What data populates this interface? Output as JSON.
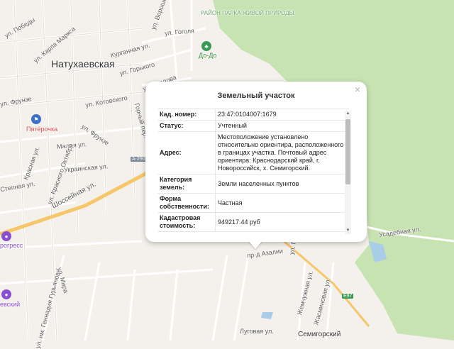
{
  "map": {
    "streets": [
      "ул. Победы",
      "ул. Карла Маркса",
      "ул. Вороши",
      "ул. Гоголя",
      "Курганная ул.",
      "ул. Горького",
      "ул. Чкалова",
      "ул. Котовского",
      "ул. Фрунзе",
      "Горный пер.",
      "ул. Фрунзе",
      "Малая ул.",
      "Красная ул.",
      "ул. Красного Октября",
      "Украинская ул.",
      "Степная ул.",
      "Шоссейная ул.",
      "пр-д Азалии",
      "ул. Гавр.",
      "Усадебная ул.",
      "Жемчужная ул.",
      "Жасминовая ул.",
      "ул. Мира",
      "ул. им. Геннадия Гурьянова",
      "Луговая ул."
    ],
    "places": {
      "city": "Натухаевская",
      "park": "РАЙОН ПАРКА ЖИВОЙ ПРИРОДЫ",
      "poi_dodo": "До-До",
      "poi_pyaterochka": "Пятёрочка",
      "poi_progress": "рогресс",
      "poi_vesky": "евский",
      "village": "Семигорский"
    },
    "road_badges": [
      "А-290",
      "Е97"
    ]
  },
  "popup": {
    "title": "Земельный участок",
    "close_glyph": "×",
    "rows": [
      {
        "key": "Кад. номер:",
        "value": "23:47:0104007:1679"
      },
      {
        "key": "Статус:",
        "value": "Учтенный"
      },
      {
        "key": "Адрес:",
        "value": "Местоположение установлено относительно ориентира, расположенного в границах участка. Почтовый адрес ориентира: Краснодарский край, г. Новороссийск, х. Семигорский."
      },
      {
        "key": "Категория земель:",
        "value": "Земли населенных пунктов"
      },
      {
        "key": "Форма собственности:",
        "value": "Частная"
      },
      {
        "key": "Кадастровая стоимость:",
        "value": "949217.44 руб"
      }
    ],
    "scroll_up": "▲",
    "scroll_down": "▼"
  },
  "colors": {
    "forest": "#c8e3b2",
    "road_major": "#f5c76a",
    "road_minor": "#ffffff",
    "background": "#f4f1ec"
  }
}
